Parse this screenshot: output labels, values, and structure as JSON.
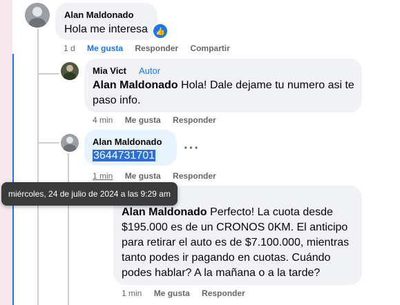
{
  "comments": [
    {
      "author": "Alan Maldonado",
      "text": "Hola me interesa",
      "time": "1 d",
      "actions": [
        "Me gusta",
        "Responder",
        "Compartir"
      ],
      "reaction_icon": "thumbs-up-icon"
    },
    {
      "author": "Mia Vict",
      "author_badge": "Autor",
      "mention": "Alan Maldonado",
      "text": "Hola! Dale dejame tu numero asi te paso info.",
      "time": "4 min",
      "actions": [
        "Me gusta",
        "Responder"
      ]
    },
    {
      "author": "Alan Maldonado",
      "text": "3644731701",
      "time": "1 min",
      "actions": [
        "Me gusta",
        "Responder"
      ],
      "more_icon": "more-options-icon"
    },
    {
      "mention": "Alan Maldonado",
      "text": "Perfecto! La cuota desde $195.000 es de un CRONOS 0KM. El anticipo para retirar el auto es de $7.100.000, mientras tanto podes ir pagando en cuotas. Cuándo podes hablar? A la mañana o a la tarde?",
      "time": "1 min",
      "actions": [
        "Me gusta",
        "Responder"
      ]
    }
  ],
  "tooltip": {
    "text": "miércoles, 24 de julio de 2024 a las 9:29 am"
  },
  "colors": {
    "accent": "#1877f2",
    "bubble": "#f0f2f5",
    "secondary_text": "#65676b",
    "tooltip_bg": "#3a3b3c"
  }
}
